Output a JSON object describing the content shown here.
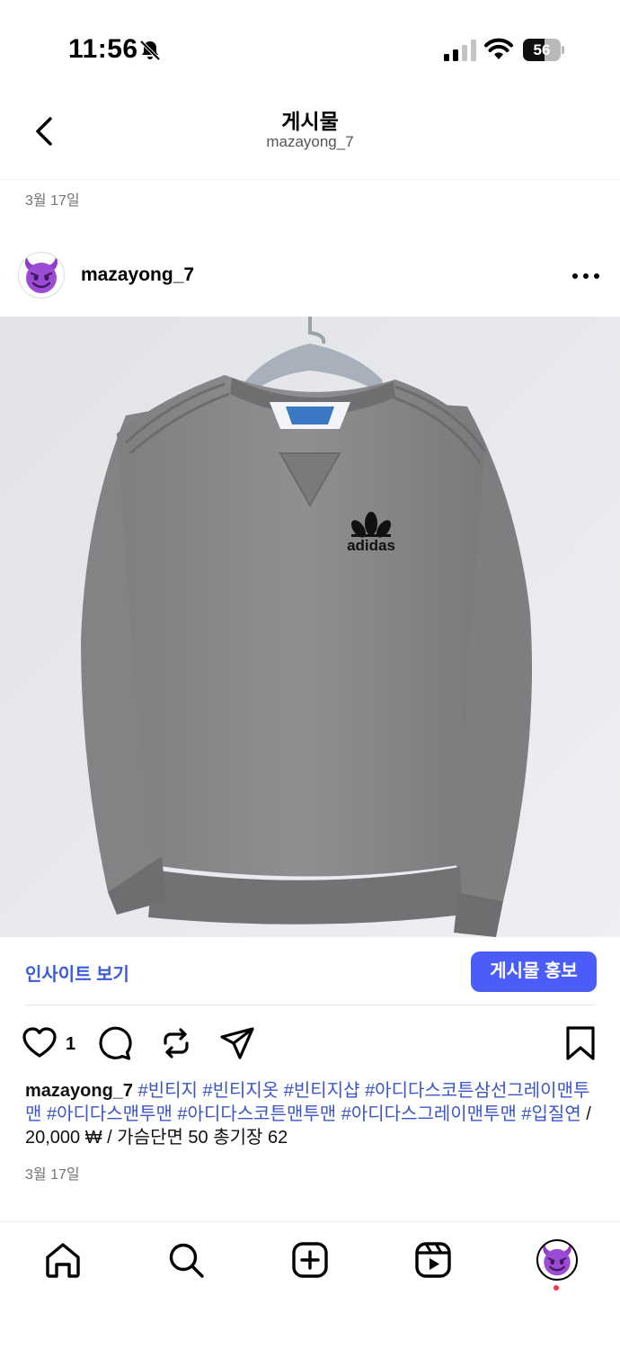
{
  "status_bar": {
    "time": "11:56",
    "battery_level": "56",
    "battery_fraction": 0.56,
    "icons": [
      "bell-slash-icon",
      "cellular-signal-icon",
      "wifi-icon",
      "battery-icon"
    ]
  },
  "nav": {
    "title": "게시물",
    "subtitle": "mazayong_7",
    "back_icon": "chevron-left-icon"
  },
  "top_date": "3월 17일",
  "post": {
    "username": "mazayong_7",
    "avatar_icon": "smiling-devil-emoji",
    "more_icon": "more-horizontal-icon",
    "image_alt": "adidas",
    "insights_label": "인사이트 보기",
    "promote_label": "게시물 홍보",
    "like_count": "1",
    "action_icons": [
      "heart-icon",
      "comment-icon",
      "repost-icon",
      "share-icon",
      "bookmark-icon"
    ],
    "caption": {
      "username": "mazayong_7",
      "tags_line": "#빈티지 #빈티지옷 #빈티지샵 #아디다스코튼삼선그레이맨투맨 #아디다스맨투맨 #아디다스코튼맨투맨 #아디다스그레이맨투맨 #입질연",
      "suffix": " / 20,000 ₩ / 가슴단면 50 총기장 62"
    },
    "date": "3월 17일"
  },
  "tab_bar": {
    "icons": [
      "home-icon",
      "search-icon",
      "create-post-icon",
      "reels-icon",
      "profile-avatar"
    ],
    "accent_dot_color": "#ff3040"
  },
  "colors": {
    "link_blue": "#3b5bdb",
    "button_blue": "#4a5df9",
    "hashtag_blue": "#3b56c6",
    "muted_gray": "#737373"
  }
}
